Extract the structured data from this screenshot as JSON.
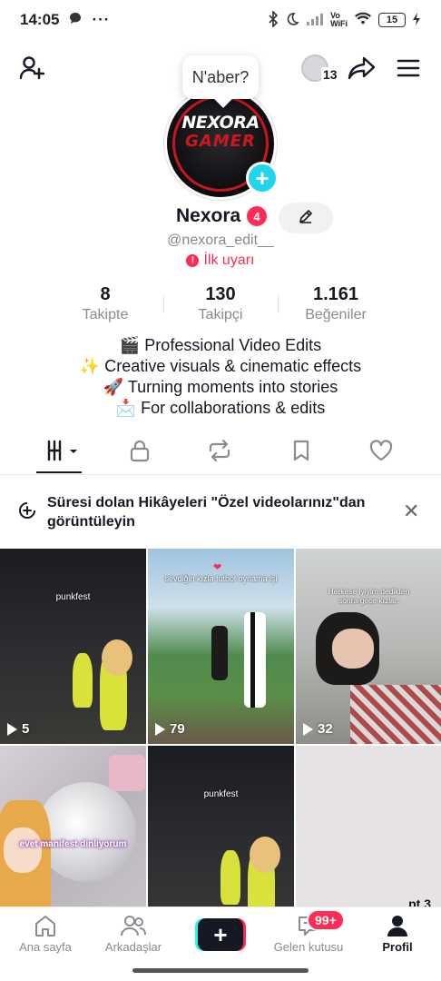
{
  "status_bar": {
    "time": "14:05",
    "left_icons": [
      "chat-bubble-icon",
      "more-dots-icon"
    ],
    "right_icons": [
      "bluetooth-icon",
      "moon-icon",
      "signal-icon",
      "vowifi-icon",
      "wifi-icon",
      "battery-icon",
      "charging-icon"
    ],
    "vowifi_label": "Vo\nWiFi",
    "battery": "15"
  },
  "top_bar": {
    "add_friend_icon": "add-user-icon",
    "coins_count": "13",
    "share_icon": "share-icon",
    "menu_icon": "hamburger-menu-icon"
  },
  "profile": {
    "note_bubble": "N'aber?",
    "avatar_text_1": "NEXORA",
    "avatar_text_2": "GAMER",
    "display_name": "Nexora",
    "notification_count": "4",
    "handle": "@nexora_edit__",
    "warning": "İlk uyarı",
    "stats": [
      {
        "value": "8",
        "label": "Takipte"
      },
      {
        "value": "130",
        "label": "Takipçi"
      },
      {
        "value": "1.161",
        "label": "Beğeniler"
      }
    ],
    "bio": [
      "🎬 Professional Video Edits",
      "✨ Creative visuals & cinematic effects",
      "🚀 Turning moments into stories",
      "📩 For collaborations & edits"
    ]
  },
  "tabs": [
    "videos-grid-icon",
    "lock-icon",
    "repost-icon",
    "bookmark-icon",
    "heart-icon"
  ],
  "banner": {
    "text": "Süresi dolan Hikâyeleri \"Özel videolarınız\"dan görüntüleyin"
  },
  "videos": [
    {
      "caption": "punkfest",
      "views": "5"
    },
    {
      "caption": "sevdiğin kızla futbol oynama işi",
      "views": "79"
    },
    {
      "caption": "Herkese iyiyim dedikten sonra gece kızlar:",
      "views": "32"
    },
    {
      "caption": "evet manifest dinliyorum",
      "views": ""
    },
    {
      "caption": "punkfest",
      "views": ""
    },
    {
      "caption": "pt.3",
      "views": ""
    }
  ],
  "bottom_nav": {
    "home": "Ana sayfa",
    "friends": "Arkadaşlar",
    "inbox": "Gelen kutusu",
    "inbox_badge": "99+",
    "profile": "Profil"
  },
  "colors": {
    "accent_red": "#fe2c55",
    "accent_cyan": "#20d5ec",
    "text": "#161823",
    "secondary": "#8a8b91"
  }
}
